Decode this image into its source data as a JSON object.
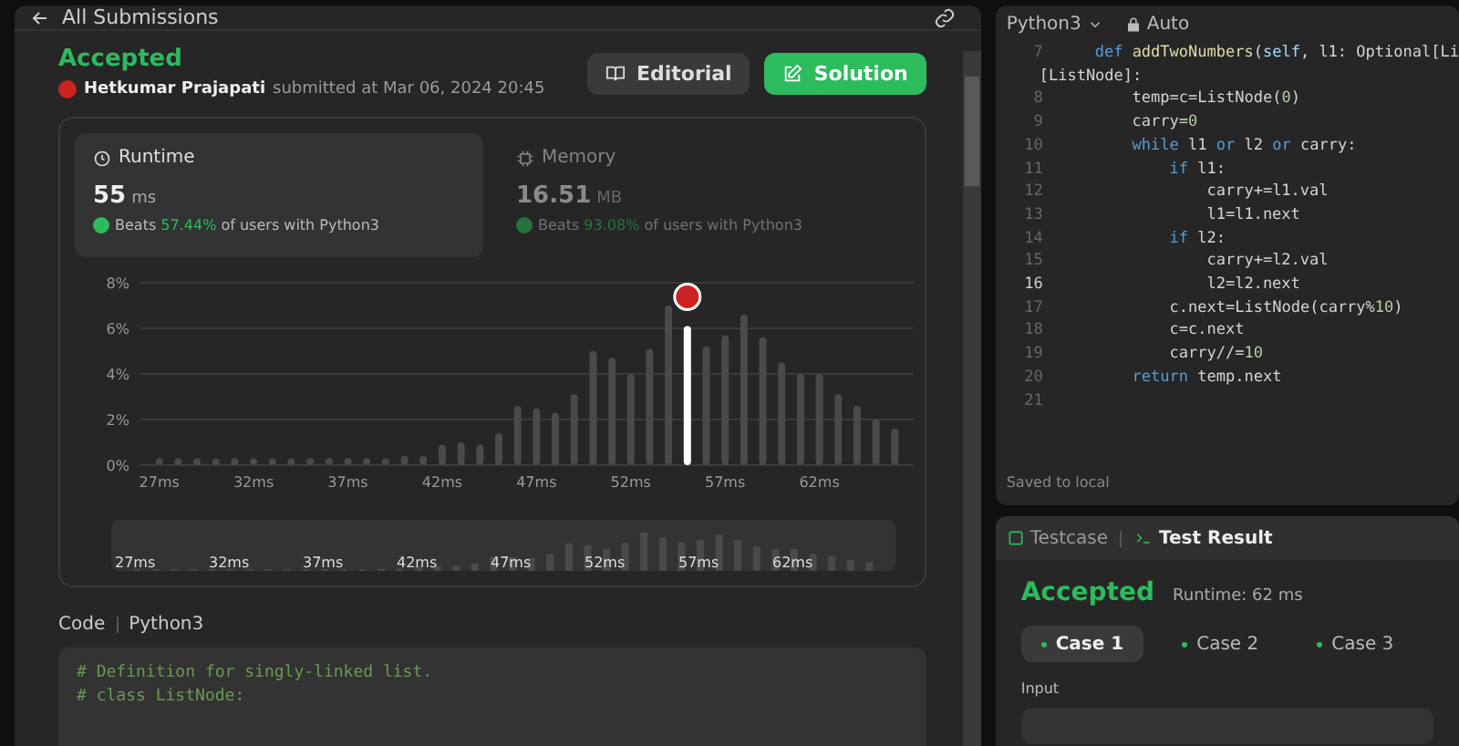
{
  "header": {
    "back_label": "All Submissions"
  },
  "submission": {
    "status": "Accepted",
    "author": "Hetkumar Prajapati",
    "submitted": "submitted at Mar 06, 2024 20:45",
    "buttons": [
      {
        "label": "Editorial",
        "kind": "secondary"
      },
      {
        "label": "Solution",
        "kind": "primary"
      }
    ]
  },
  "stats": [
    {
      "kind": "runtime",
      "title": "Runtime",
      "value": "55",
      "unit": "ms",
      "beats_prefix": "Beats",
      "beats": "57.44%",
      "beats_suffix": "of users with Python3",
      "selected": true
    },
    {
      "kind": "memory",
      "title": "Memory",
      "value": "16.51",
      "unit": "MB",
      "beats_prefix": "Beats",
      "beats": "93.08%",
      "beats_suffix": "of users with Python3",
      "selected": false
    }
  ],
  "chart_data": {
    "type": "bar",
    "grid": true,
    "x": [
      27,
      28,
      29,
      30,
      31,
      32,
      33,
      34,
      35,
      36,
      37,
      38,
      39,
      40,
      41,
      42,
      43,
      44,
      45,
      46,
      47,
      48,
      49,
      50,
      51,
      52,
      53,
      54,
      55,
      56,
      57,
      58,
      59,
      60,
      61,
      62,
      63,
      64,
      65,
      66
    ],
    "values": [
      0.3,
      0.3,
      0.3,
      0.3,
      0.3,
      0.3,
      0.3,
      0.3,
      0.3,
      0.3,
      0.3,
      0.3,
      0.3,
      0.4,
      0.4,
      0.9,
      1.0,
      0.9,
      1.4,
      2.6,
      2.5,
      2.3,
      3.1,
      5.0,
      4.7,
      4.0,
      5.1,
      7.0,
      6.1,
      5.2,
      5.7,
      6.6,
      5.6,
      4.5,
      4.0,
      4.0,
      3.1,
      2.6,
      2.0,
      1.6
    ],
    "xlim": [
      26,
      67
    ],
    "ylim": [
      0,
      8
    ],
    "yticks": [
      {
        "value": 0,
        "label": "0%"
      },
      {
        "value": 2,
        "label": "2%"
      },
      {
        "value": 4,
        "label": "4%"
      },
      {
        "value": 6,
        "label": "6%"
      },
      {
        "value": 8,
        "label": "8%"
      }
    ],
    "xticks": [
      {
        "value": 27,
        "label": "27ms"
      },
      {
        "value": 32,
        "label": "32ms"
      },
      {
        "value": 37,
        "label": "37ms"
      },
      {
        "value": 42,
        "label": "42ms"
      },
      {
        "value": 47,
        "label": "47ms"
      },
      {
        "value": 52,
        "label": "52ms"
      },
      {
        "value": 57,
        "label": "57ms"
      },
      {
        "value": 62,
        "label": "62ms"
      }
    ]
  },
  "navigator": {
    "labels": [
      "27ms",
      "32ms",
      "37ms",
      "42ms",
      "47ms",
      "52ms",
      "57ms",
      "62ms"
    ]
  },
  "code_section": {
    "title": "Code",
    "language": "Python3",
    "lines": [
      "# Definition for singly-linked list.",
      "# class ListNode:"
    ]
  },
  "editor": {
    "language": "Python3",
    "mode": "Auto",
    "status": "Saved to local",
    "lines": [
      {
        "number": "7",
        "current": false,
        "text": "    def addTwoNumbers(self, l1: Optional[Li",
        "continuation": "[ListNode]:"
      },
      {
        "number": "8",
        "current": false,
        "text": "        temp=c=ListNode(0)"
      },
      {
        "number": "9",
        "current": false,
        "text": "        carry=0"
      },
      {
        "number": "10",
        "current": false,
        "text": "        while l1 or l2 or carry:"
      },
      {
        "number": "11",
        "current": false,
        "text": "            if l1:"
      },
      {
        "number": "12",
        "current": false,
        "text": "                carry+=l1.val"
      },
      {
        "number": "13",
        "current": false,
        "text": "                l1=l1.next"
      },
      {
        "number": "14",
        "current": false,
        "text": "            if l2:"
      },
      {
        "number": "15",
        "current": false,
        "text": "                carry+=l2.val"
      },
      {
        "number": "16",
        "current": true,
        "text": "                l2=l2.next"
      },
      {
        "number": "17",
        "current": false,
        "text": "            c.next=ListNode(carry%10)"
      },
      {
        "number": "18",
        "current": false,
        "text": "            c=c.next"
      },
      {
        "number": "19",
        "current": false,
        "text": "            carry//=10"
      },
      {
        "number": "20",
        "current": false,
        "text": "        return temp.next"
      },
      {
        "number": "21",
        "current": false
      }
    ]
  },
  "result": {
    "tabs": [
      {
        "label": "Testcase",
        "selected": false
      },
      {
        "label": "Test Result",
        "selected": true
      }
    ],
    "status": "Accepted",
    "runtime": "Runtime: 62 ms",
    "cases": [
      {
        "label": "Case 1",
        "selected": true
      },
      {
        "label": "Case 2",
        "selected": false
      },
      {
        "label": "Case 3",
        "selected": false
      }
    ],
    "input_label": "Input"
  }
}
